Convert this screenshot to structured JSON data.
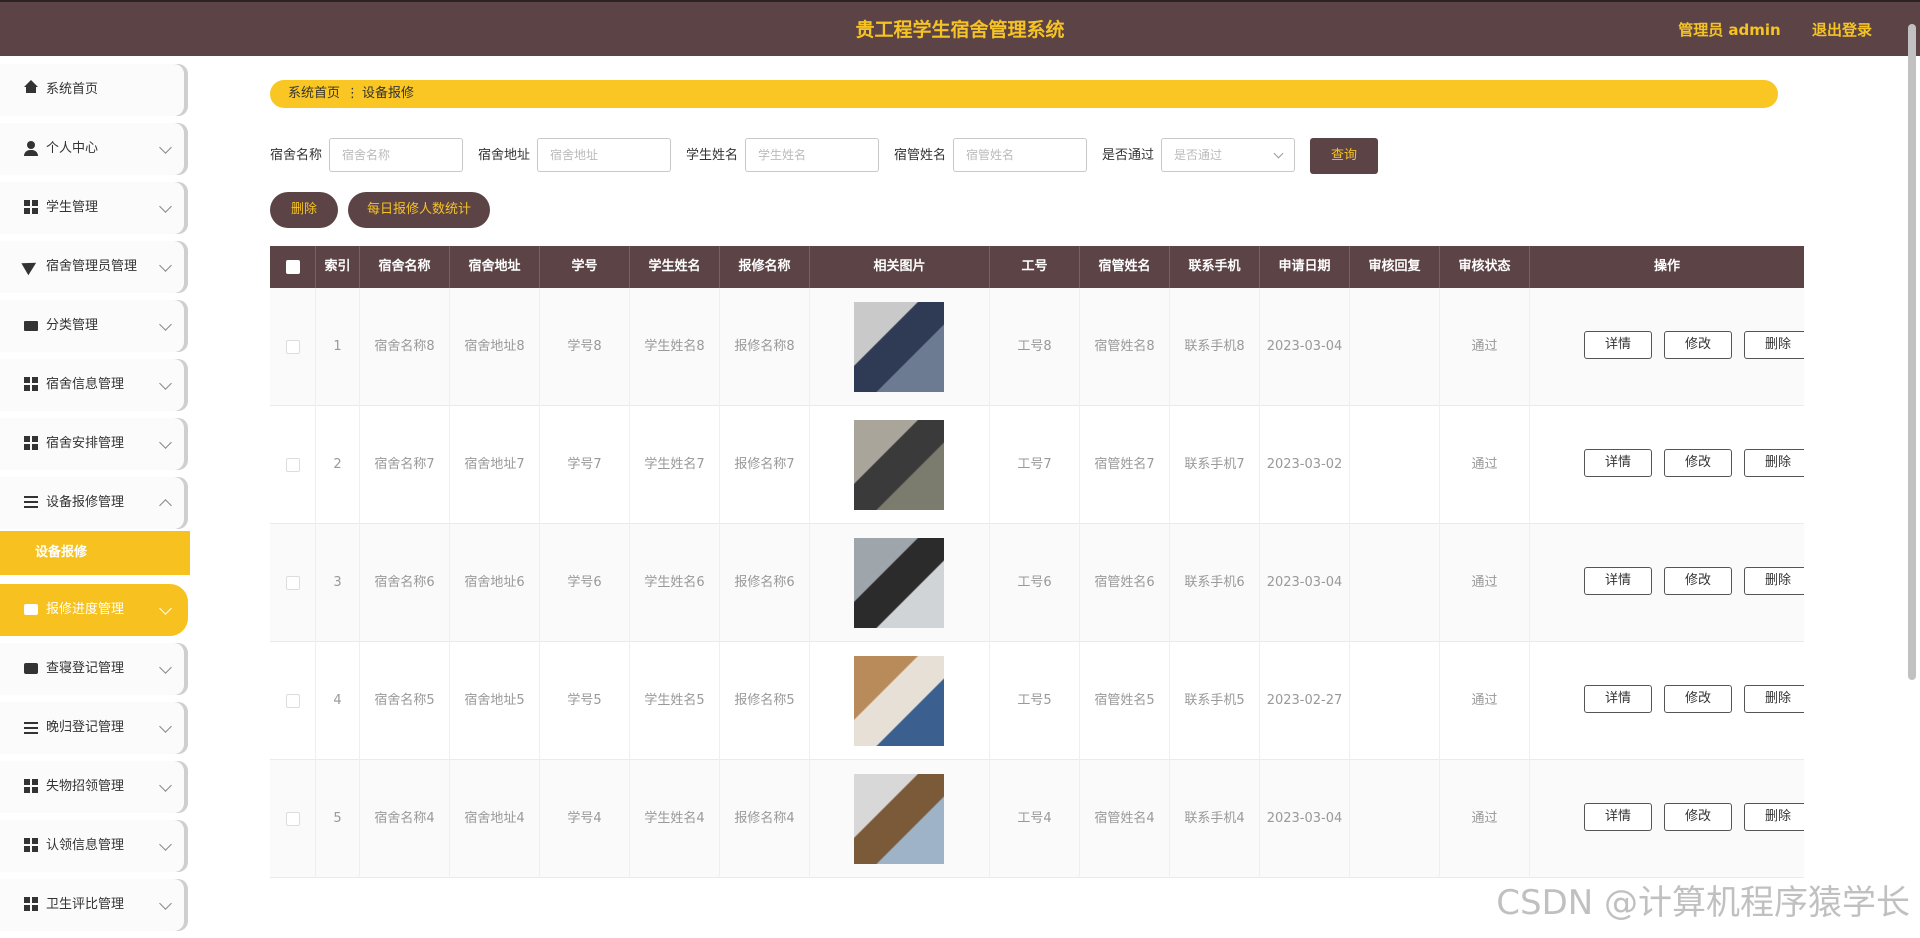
{
  "header": {
    "app_title": "贵工程学生宿舍管理系统",
    "admin_label": "管理员 admin",
    "logout_label": "退出登录"
  },
  "sidebar": {
    "items": [
      {
        "label": "系统首页",
        "icon": "home-icon"
      },
      {
        "label": "个人中心",
        "icon": "user-icon"
      },
      {
        "label": "学生管理",
        "icon": "grid-icon"
      },
      {
        "label": "宿舍管理员管理",
        "icon": "send-icon"
      },
      {
        "label": "分类管理",
        "icon": "bag-icon"
      },
      {
        "label": "宿舍信息管理",
        "icon": "grid-icon"
      },
      {
        "label": "宿舍安排管理",
        "icon": "grid-icon"
      },
      {
        "label": "设备报修管理",
        "icon": "list-icon"
      },
      {
        "label": "报修进度管理",
        "icon": "box-icon"
      },
      {
        "label": "查寝登记管理",
        "icon": "box-icon"
      },
      {
        "label": "晚归登记管理",
        "icon": "sliders-icon"
      },
      {
        "label": "失物招领管理",
        "icon": "grid-icon"
      },
      {
        "label": "认领信息管理",
        "icon": "grid-icon"
      },
      {
        "label": "卫生评比管理",
        "icon": "grid-icon"
      }
    ],
    "active_sub": "设备报修"
  },
  "breadcrumb": {
    "home": "系统首页",
    "separator": "⋮",
    "current": "设备报修"
  },
  "search": {
    "fields": [
      {
        "label": "宿舍名称",
        "placeholder": "宿舍名称"
      },
      {
        "label": "宿舍地址",
        "placeholder": "宿舍地址"
      },
      {
        "label": "学生姓名",
        "placeholder": "学生姓名"
      },
      {
        "label": "宿管姓名",
        "placeholder": "宿管姓名"
      },
      {
        "label": "是否通过",
        "placeholder": "是否通过"
      }
    ],
    "query_label": "查询"
  },
  "actions": {
    "delete_label": "删除",
    "stats_label": "每日报修人数统计"
  },
  "table": {
    "columns": [
      "索引",
      "宿舍名称",
      "宿舍地址",
      "学号",
      "学生姓名",
      "报修名称",
      "相关图片",
      "工号",
      "宿管姓名",
      "联系手机",
      "申请日期",
      "审核回复",
      "审核状态",
      "操作"
    ],
    "row_actions": {
      "detail": "详情",
      "edit": "修改",
      "delete": "删除"
    },
    "rows": [
      {
        "index": "1",
        "dorm_name": "宿舍名称8",
        "dorm_addr": "宿舍地址8",
        "student_no": "学号8",
        "student_name": "学生姓名8",
        "repair_name": "报修名称8",
        "staff_no": "工号8",
        "manager": "宿管姓名8",
        "phone": "联系手机8",
        "date": "2023-03-04",
        "reply": "",
        "status": "通过"
      },
      {
        "index": "2",
        "dorm_name": "宿舍名称7",
        "dorm_addr": "宿舍地址7",
        "student_no": "学号7",
        "student_name": "学生姓名7",
        "repair_name": "报修名称7",
        "staff_no": "工号7",
        "manager": "宿管姓名7",
        "phone": "联系手机7",
        "date": "2023-03-02",
        "reply": "",
        "status": "通过"
      },
      {
        "index": "3",
        "dorm_name": "宿舍名称6",
        "dorm_addr": "宿舍地址6",
        "student_no": "学号6",
        "student_name": "学生姓名6",
        "repair_name": "报修名称6",
        "staff_no": "工号6",
        "manager": "宿管姓名6",
        "phone": "联系手机6",
        "date": "2023-03-04",
        "reply": "",
        "status": "通过"
      },
      {
        "index": "4",
        "dorm_name": "宿舍名称5",
        "dorm_addr": "宿舍地址5",
        "student_no": "学号5",
        "student_name": "学生姓名5",
        "repair_name": "报修名称5",
        "staff_no": "工号5",
        "manager": "宿管姓名5",
        "phone": "联系手机5",
        "date": "2023-02-27",
        "reply": "",
        "status": "通过"
      },
      {
        "index": "5",
        "dorm_name": "宿舍名称4",
        "dorm_addr": "宿舍地址4",
        "student_no": "学号4",
        "student_name": "学生姓名4",
        "repair_name": "报修名称4",
        "staff_no": "工号4",
        "manager": "宿管姓名4",
        "phone": "联系手机4",
        "date": "2023-03-04",
        "reply": "",
        "status": "通过"
      }
    ]
  },
  "watermark": "CSDN @计算机程序猿学长",
  "colors": {
    "header_bg": "#5c4346",
    "accent": "#f9c623"
  }
}
